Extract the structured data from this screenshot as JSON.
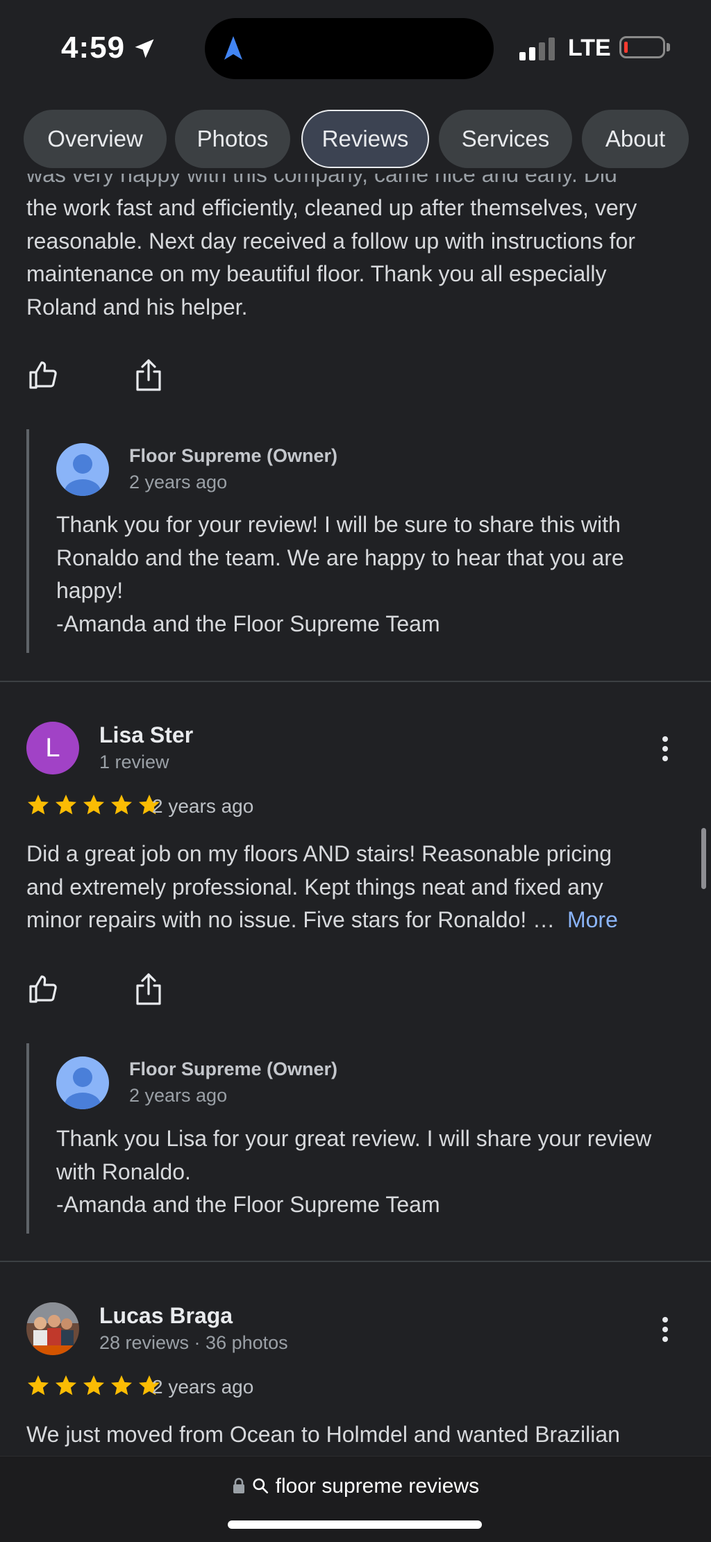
{
  "status_bar": {
    "time": "4:59",
    "network": "LTE"
  },
  "tabs": [
    {
      "label": "Overview"
    },
    {
      "label": "Photos"
    },
    {
      "label": "Reviews",
      "active": true
    },
    {
      "label": "Services"
    },
    {
      "label": "About"
    }
  ],
  "review1": {
    "partial_top_line": "was very happy with this company, came nice and early. Did",
    "text_lines": [
      "the work fast and efficiently, cleaned up after themselves, very",
      "reasonable. Next day received a follow up with instructions for",
      "maintenance on my beautiful floor. Thank you all especially",
      "Roland and his helper."
    ],
    "owner_reply": {
      "name": "Floor Supreme (Owner)",
      "time": "2 years ago",
      "lines": [
        "Thank you for your review! I will be sure to share this with",
        "Ronaldo and the team. We are happy to hear that you are",
        "happy!",
        "-Amanda and the Floor Supreme Team"
      ]
    }
  },
  "review2": {
    "avatar_letter": "L",
    "avatar_color": "#a142c6",
    "name": "Lisa Ster",
    "sub": "1 review",
    "rating": 5,
    "time": "2 years ago",
    "text_lines": [
      "Did a great job on my floors AND stairs! Reasonable pricing",
      "and extremely professional. Kept things neat and fixed any",
      "minor repairs with no issue. Five stars for Ronaldo! …"
    ],
    "more_label": "More",
    "owner_reply": {
      "name": "Floor Supreme (Owner)",
      "time": "2 years ago",
      "lines": [
        "Thank you Lisa for your great review. I will share your review",
        "with Ronaldo.",
        "-Amanda and the Floor Supreme Team"
      ]
    }
  },
  "review3": {
    "name": "Lucas Braga",
    "sub": "28 reviews · 36 photos",
    "rating": 5,
    "time": "2 years ago",
    "text_first_line": "We just moved from Ocean to Holmdel and wanted Brazilian"
  },
  "url_bar": {
    "text": "floor supreme reviews"
  },
  "colors": {
    "star": "#fbbc04",
    "link": "#8ab4f8",
    "background": "#202124"
  },
  "icons": [
    "location-arrow-icon",
    "maps-navigation-icon",
    "thumbs-up-icon",
    "share-icon",
    "more-vert-icon",
    "lock-icon",
    "search-icon"
  ]
}
